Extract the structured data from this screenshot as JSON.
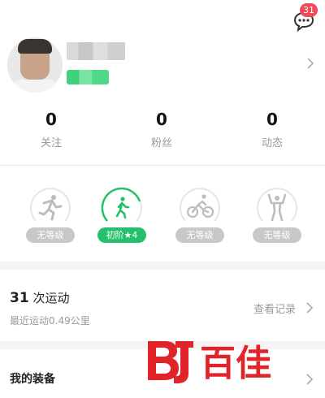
{
  "notifications": {
    "badge_count": "31",
    "icon": "chat-bubble-icon"
  },
  "profile": {
    "avatar": "user-avatar",
    "name": "",
    "level_badge": ""
  },
  "stats": [
    {
      "value": "0",
      "label": "关注"
    },
    {
      "value": "0",
      "label": "粉丝"
    },
    {
      "value": "0",
      "label": "动态"
    }
  ],
  "sports": [
    {
      "icon": "running-icon",
      "tag": "无等级",
      "active": false
    },
    {
      "icon": "walking-icon",
      "tag": "初阶★4",
      "active": true
    },
    {
      "icon": "cycling-icon",
      "tag": "无等级",
      "active": false
    },
    {
      "icon": "fitness-icon",
      "tag": "无等级",
      "active": false
    }
  ],
  "workouts": {
    "count": "31",
    "count_suffix": "次运动",
    "recent": "最近运动0.49公里",
    "view_records": "查看记录"
  },
  "equipment": {
    "title": "我的装备"
  },
  "watermark": {
    "text": "百佳",
    "logo": "bj-logo"
  },
  "colors": {
    "accent": "#24c06b",
    "badge": "#ee4b57",
    "inactive_tag": "#c8c8c8",
    "watermark": "#e1242a"
  }
}
